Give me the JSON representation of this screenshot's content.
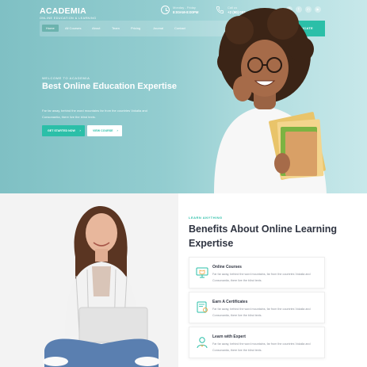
{
  "brand": {
    "name": "ACADEMIA",
    "tagline": "ONLINE EDUCATION & LEARNING"
  },
  "topbar": {
    "hours_label": "Monday - Friday",
    "hours_value": "8:00AM-8:00PM",
    "phone_label": "Call us",
    "phone_value": "+2 (90) 002 ..."
  },
  "socials": [
    {
      "icon": "facebook-icon",
      "glyph": "f"
    },
    {
      "icon": "twitter-icon",
      "glyph": "t"
    },
    {
      "icon": "instagram-icon",
      "glyph": "in"
    },
    {
      "icon": "youtube-icon",
      "glyph": "▶"
    }
  ],
  "nav": {
    "items": [
      "Home",
      "All Courses",
      "About",
      "Team",
      "Pricing",
      "Journal",
      "Contact"
    ],
    "active_index": 0,
    "cta": "GET CERTIFICATE"
  },
  "hero": {
    "kicker": "WELCOME TO ACADEMIA",
    "title": "Best Online Education Expertise",
    "description": "Far far away, behind the word mountains far from the countries Vokalia and Consonantia, there live the blind texts.",
    "primary_button": "GET STARTED NOW",
    "secondary_button": "VIEW COURSE"
  },
  "benefits": {
    "kicker": "LEARN ANYTHING",
    "title": "Benefits About Online Learning Expertise",
    "cards": [
      {
        "icon": "monitor-book-icon",
        "title": "Online Courses",
        "description": "Far far away, behind the word mountains, far from the countries Vokalia and Consonantia, there live the blind texts."
      },
      {
        "icon": "certificate-icon",
        "title": "Earn A Certificates",
        "description": "Far far away, behind the word mountains, far from the countries Vokalia and Consonantia, there live the blind texts."
      },
      {
        "icon": "expert-icon",
        "title": "Learn with Expert",
        "description": "Far far away, behind the word mountains, far from the countries Vokalia and Consonantia, there live the blind texts."
      }
    ]
  },
  "colors": {
    "accent": "#2bbfa8",
    "hero_bg": "#93cdd0",
    "text_dark": "#2f3441"
  }
}
